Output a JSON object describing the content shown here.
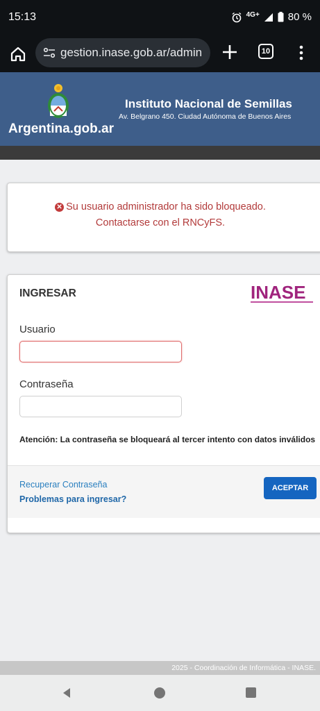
{
  "status_bar": {
    "time": "15:13",
    "network": "4G+",
    "battery": "80 %",
    "icons": [
      "alarm-icon",
      "signal-icon",
      "battery-icon"
    ]
  },
  "browser": {
    "url": "gestion.inase.gob.ar/admin",
    "tab_count": "10",
    "icons": [
      "home-icon",
      "site-settings-icon",
      "new-tab-icon",
      "tabs-icon",
      "more-menu-icon"
    ]
  },
  "site_header": {
    "brand": "Argentina.gob.ar",
    "institute_name": "Instituto Nacional de Semillas",
    "address": "Av. Belgrano 450. Ciudad Autónoma de Buenos Aires",
    "background_color": "#3e5e8a"
  },
  "alert": {
    "line1": "Su usuario administrador ha sido bloqueado.",
    "line2": "Contactarse con el RNCyFS.",
    "color": "#b23a3a"
  },
  "login": {
    "title": "INGRESAR",
    "logo_text": "INASE",
    "user_label": "Usuario",
    "user_value": "",
    "password_label": "Contraseña",
    "password_value": "",
    "warning": "Atención: La contraseña se bloqueará al tercer intento con datos inválidos",
    "recover_link": "Recuperar Contraseña",
    "problems_link": "Problemas para ingresar?",
    "accept_button": "ACEPTAR",
    "accent_color": "#1565c0"
  },
  "footer": {
    "text": "2025 - Coordinación de Informática - INASE."
  },
  "nav_bar": {
    "icons": [
      "back-icon",
      "home-circle-icon",
      "recents-icon"
    ]
  }
}
